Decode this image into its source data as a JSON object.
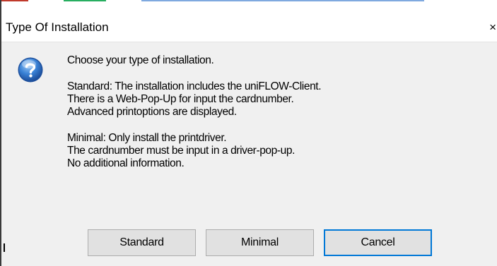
{
  "dialog": {
    "title": "Type Of Installation",
    "close_fragment": "X",
    "icon": "question-icon",
    "message_lines": [
      "Choose your type of installation.",
      "",
      "Standard: The installation includes the uniFLOW-Client.",
      "There is a Web-Pop-Up for input the cardnumber.",
      "Advanced printoptions are displayed.",
      "",
      "Minimal: Only install the printdriver.",
      "The cardnumber must be input in a driver-pop-up.",
      "No additional information."
    ],
    "buttons": {
      "standard": "Standard",
      "minimal": "Minimal",
      "cancel": "Cancel"
    }
  },
  "colors": {
    "dialog_background": "#f0f0f0",
    "titlebar_background": "#ffffff",
    "button_background": "#e1e1e1",
    "default_button_border": "#0078d7",
    "icon_blue": "#2a6fc9"
  }
}
